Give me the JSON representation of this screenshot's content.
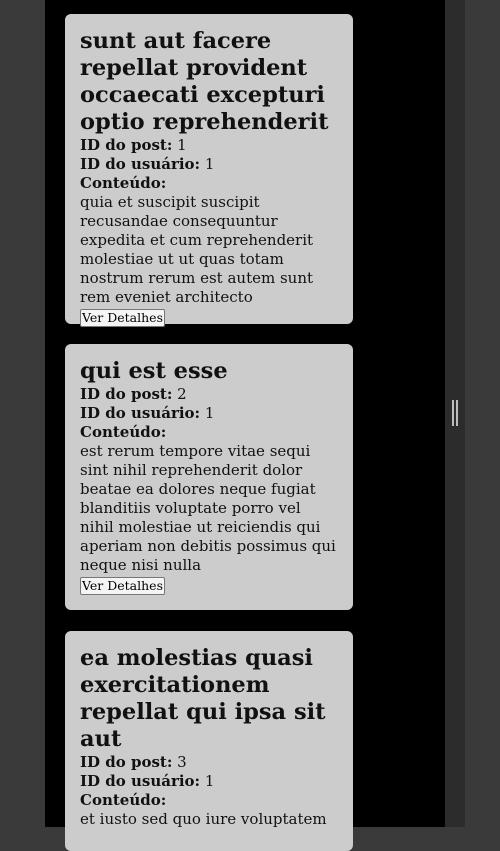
{
  "labels": {
    "post_id": "ID do post:",
    "user_id": "ID do usuário:",
    "content": "Conteúdo:",
    "details_button": "Ver Detalhes"
  },
  "posts": [
    {
      "title": "sunt aut facere repellat provident occaecati excepturi optio reprehenderit",
      "id": "1",
      "userId": "1",
      "body": "quia et suscipit suscipit recusandae consequuntur expedita et cum reprehenderit molestiae ut ut quas totam nostrum rerum est autem sunt rem eveniet architecto"
    },
    {
      "title": "qui est esse",
      "id": "2",
      "userId": "1",
      "body": "est rerum tempore vitae sequi sint nihil reprehenderit dolor beatae ea dolores neque fugiat blanditiis voluptate porro vel nihil molestiae ut reiciendis qui aperiam non debitis possimus qui neque nisi nulla"
    },
    {
      "title": "ea molestias quasi exercitationem repellat qui ipsa sit aut",
      "id": "3",
      "userId": "1",
      "body": "et iusto sed quo iure voluptatem"
    }
  ]
}
